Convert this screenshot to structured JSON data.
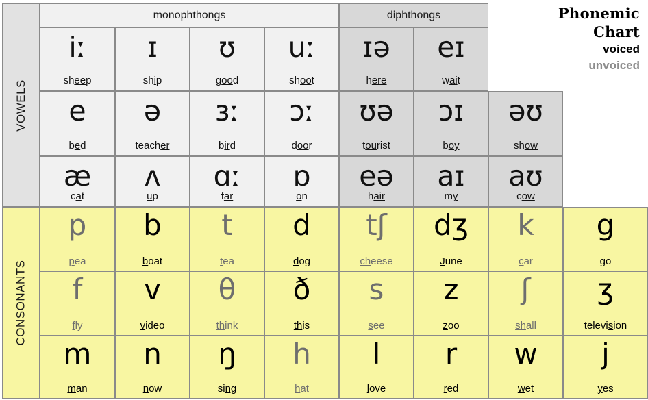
{
  "title": {
    "line1": "Phonemic",
    "line2": "Chart",
    "legend_voiced": "voiced",
    "legend_unvoiced": "unvoiced",
    "color_voiced": "#000000",
    "color_unvoiced": "#8d8d8d"
  },
  "sections": {
    "vowels_label": "VOWELS",
    "consonants_label": "CONSONANTS",
    "monophthongs_label": "monophthongs",
    "diphthongs_label": "diphthongs"
  },
  "colors": {
    "monophthong_bg": "#f1f1f1",
    "diphthong_bg": "#d8d8d8",
    "consonant_bg": "#f8f6a2",
    "vowel_side_bg": "#e2e2e2",
    "border": "#8a8a8a"
  },
  "vowels": {
    "row1": [
      {
        "symbol": "iː",
        "word_pre": "sh",
        "word_mid": "ee",
        "word_post": "p",
        "group": "mono"
      },
      {
        "symbol": "ɪ",
        "word_pre": "sh",
        "word_mid": "i",
        "word_post": "p",
        "group": "mono"
      },
      {
        "symbol": "ʊ",
        "word_pre": "g",
        "word_mid": "oo",
        "word_post": "d",
        "group": "mono"
      },
      {
        "symbol": "uː",
        "word_pre": "sh",
        "word_mid": "oo",
        "word_post": "t",
        "group": "mono"
      },
      {
        "symbol": "ɪə",
        "word_pre": "h",
        "word_mid": "ere",
        "word_post": "",
        "group": "diph"
      },
      {
        "symbol": "eɪ",
        "word_pre": "w",
        "word_mid": "ai",
        "word_post": "t",
        "group": "diph"
      }
    ],
    "row2": [
      {
        "symbol": "e",
        "word_pre": "b",
        "word_mid": "e",
        "word_post": "d",
        "group": "mono"
      },
      {
        "symbol": "ə",
        "word_pre": "teach",
        "word_mid": "er",
        "word_post": "",
        "group": "mono"
      },
      {
        "symbol": "ɜː",
        "word_pre": "b",
        "word_mid": "ir",
        "word_post": "d",
        "group": "mono"
      },
      {
        "symbol": "ɔː",
        "word_pre": "d",
        "word_mid": "oo",
        "word_post": "r",
        "group": "mono"
      },
      {
        "symbol": "ʊə",
        "word_pre": "t",
        "word_mid": "ou",
        "word_post": "rist",
        "group": "diph"
      },
      {
        "symbol": "ɔɪ",
        "word_pre": "b",
        "word_mid": "oy",
        "word_post": "",
        "group": "diph"
      },
      {
        "symbol": "əʊ",
        "word_pre": "sh",
        "word_mid": "ow",
        "word_post": "",
        "group": "diph"
      }
    ],
    "row3": [
      {
        "symbol": "æ",
        "word_pre": "c",
        "word_mid": "a",
        "word_post": "t",
        "group": "mono"
      },
      {
        "symbol": "ʌ",
        "word_pre": "",
        "word_mid": "u",
        "word_post": "p",
        "group": "mono"
      },
      {
        "symbol": "ɑː",
        "word_pre": "f",
        "word_mid": "ar",
        "word_post": "",
        "group": "mono"
      },
      {
        "symbol": "ɒ",
        "word_pre": "",
        "word_mid": "o",
        "word_post": "n",
        "group": "mono"
      },
      {
        "symbol": "eə",
        "word_pre": "h",
        "word_mid": "air",
        "word_post": "",
        "group": "diph"
      },
      {
        "symbol": "aɪ",
        "word_pre": "m",
        "word_mid": "y",
        "word_post": "",
        "group": "diph"
      },
      {
        "symbol": "aʊ",
        "word_pre": "c",
        "word_mid": "ow",
        "word_post": "",
        "group": "diph"
      }
    ]
  },
  "consonants": {
    "row1": [
      {
        "symbol": "p",
        "word_pre": "",
        "word_mid": "p",
        "word_post": "ea",
        "voicing": "unvoiced"
      },
      {
        "symbol": "b",
        "word_pre": "",
        "word_mid": "b",
        "word_post": "oat",
        "voicing": "voiced"
      },
      {
        "symbol": "t",
        "word_pre": "",
        "word_mid": "t",
        "word_post": "ea",
        "voicing": "unvoiced"
      },
      {
        "symbol": "d",
        "word_pre": "",
        "word_mid": "d",
        "word_post": "og",
        "voicing": "voiced"
      },
      {
        "symbol": "tʃ",
        "word_pre": "",
        "word_mid": "ch",
        "word_post": "eese",
        "voicing": "unvoiced"
      },
      {
        "symbol": "dʒ",
        "word_pre": "",
        "word_mid": "J",
        "word_post": "une",
        "voicing": "voiced"
      },
      {
        "symbol": "k",
        "word_pre": "",
        "word_mid": "c",
        "word_post": "ar",
        "voicing": "unvoiced"
      },
      {
        "symbol": "g",
        "word_pre": "",
        "word_mid": "g",
        "word_post": "o",
        "voicing": "voiced"
      }
    ],
    "row2": [
      {
        "symbol": "f",
        "word_pre": "",
        "word_mid": "f",
        "word_post": "ly",
        "voicing": "unvoiced"
      },
      {
        "symbol": "v",
        "word_pre": "",
        "word_mid": "v",
        "word_post": "ideo",
        "voicing": "voiced"
      },
      {
        "symbol": "θ",
        "word_pre": "",
        "word_mid": "th",
        "word_post": "ink",
        "voicing": "unvoiced"
      },
      {
        "symbol": "ð",
        "word_pre": "",
        "word_mid": "th",
        "word_post": "is",
        "voicing": "voiced"
      },
      {
        "symbol": "s",
        "word_pre": "",
        "word_mid": "s",
        "word_post": "ee",
        "voicing": "unvoiced"
      },
      {
        "symbol": "z",
        "word_pre": "",
        "word_mid": "z",
        "word_post": "oo",
        "voicing": "voiced"
      },
      {
        "symbol": "ʃ",
        "word_pre": "",
        "word_mid": "sh",
        "word_post": "all",
        "voicing": "unvoiced"
      },
      {
        "symbol": "ʒ",
        "word_pre": "televi",
        "word_mid": "s",
        "word_post": "ion",
        "voicing": "voiced"
      }
    ],
    "row3": [
      {
        "symbol": "m",
        "word_pre": "",
        "word_mid": "m",
        "word_post": "an",
        "voicing": "voiced"
      },
      {
        "symbol": "n",
        "word_pre": "",
        "word_mid": "n",
        "word_post": "ow",
        "voicing": "voiced"
      },
      {
        "symbol": "ŋ",
        "word_pre": "si",
        "word_mid": "ng",
        "word_post": "",
        "voicing": "voiced"
      },
      {
        "symbol": "h",
        "word_pre": "",
        "word_mid": "h",
        "word_post": "at",
        "voicing": "unvoiced"
      },
      {
        "symbol": "l",
        "word_pre": "",
        "word_mid": "l",
        "word_post": "ove",
        "voicing": "voiced"
      },
      {
        "symbol": "r",
        "word_pre": "",
        "word_mid": "r",
        "word_post": "ed",
        "voicing": "voiced"
      },
      {
        "symbol": "w",
        "word_pre": "",
        "word_mid": "w",
        "word_post": "et",
        "voicing": "voiced"
      },
      {
        "symbol": "j",
        "word_pre": "",
        "word_mid": "y",
        "word_post": "es",
        "voicing": "voiced"
      }
    ]
  }
}
